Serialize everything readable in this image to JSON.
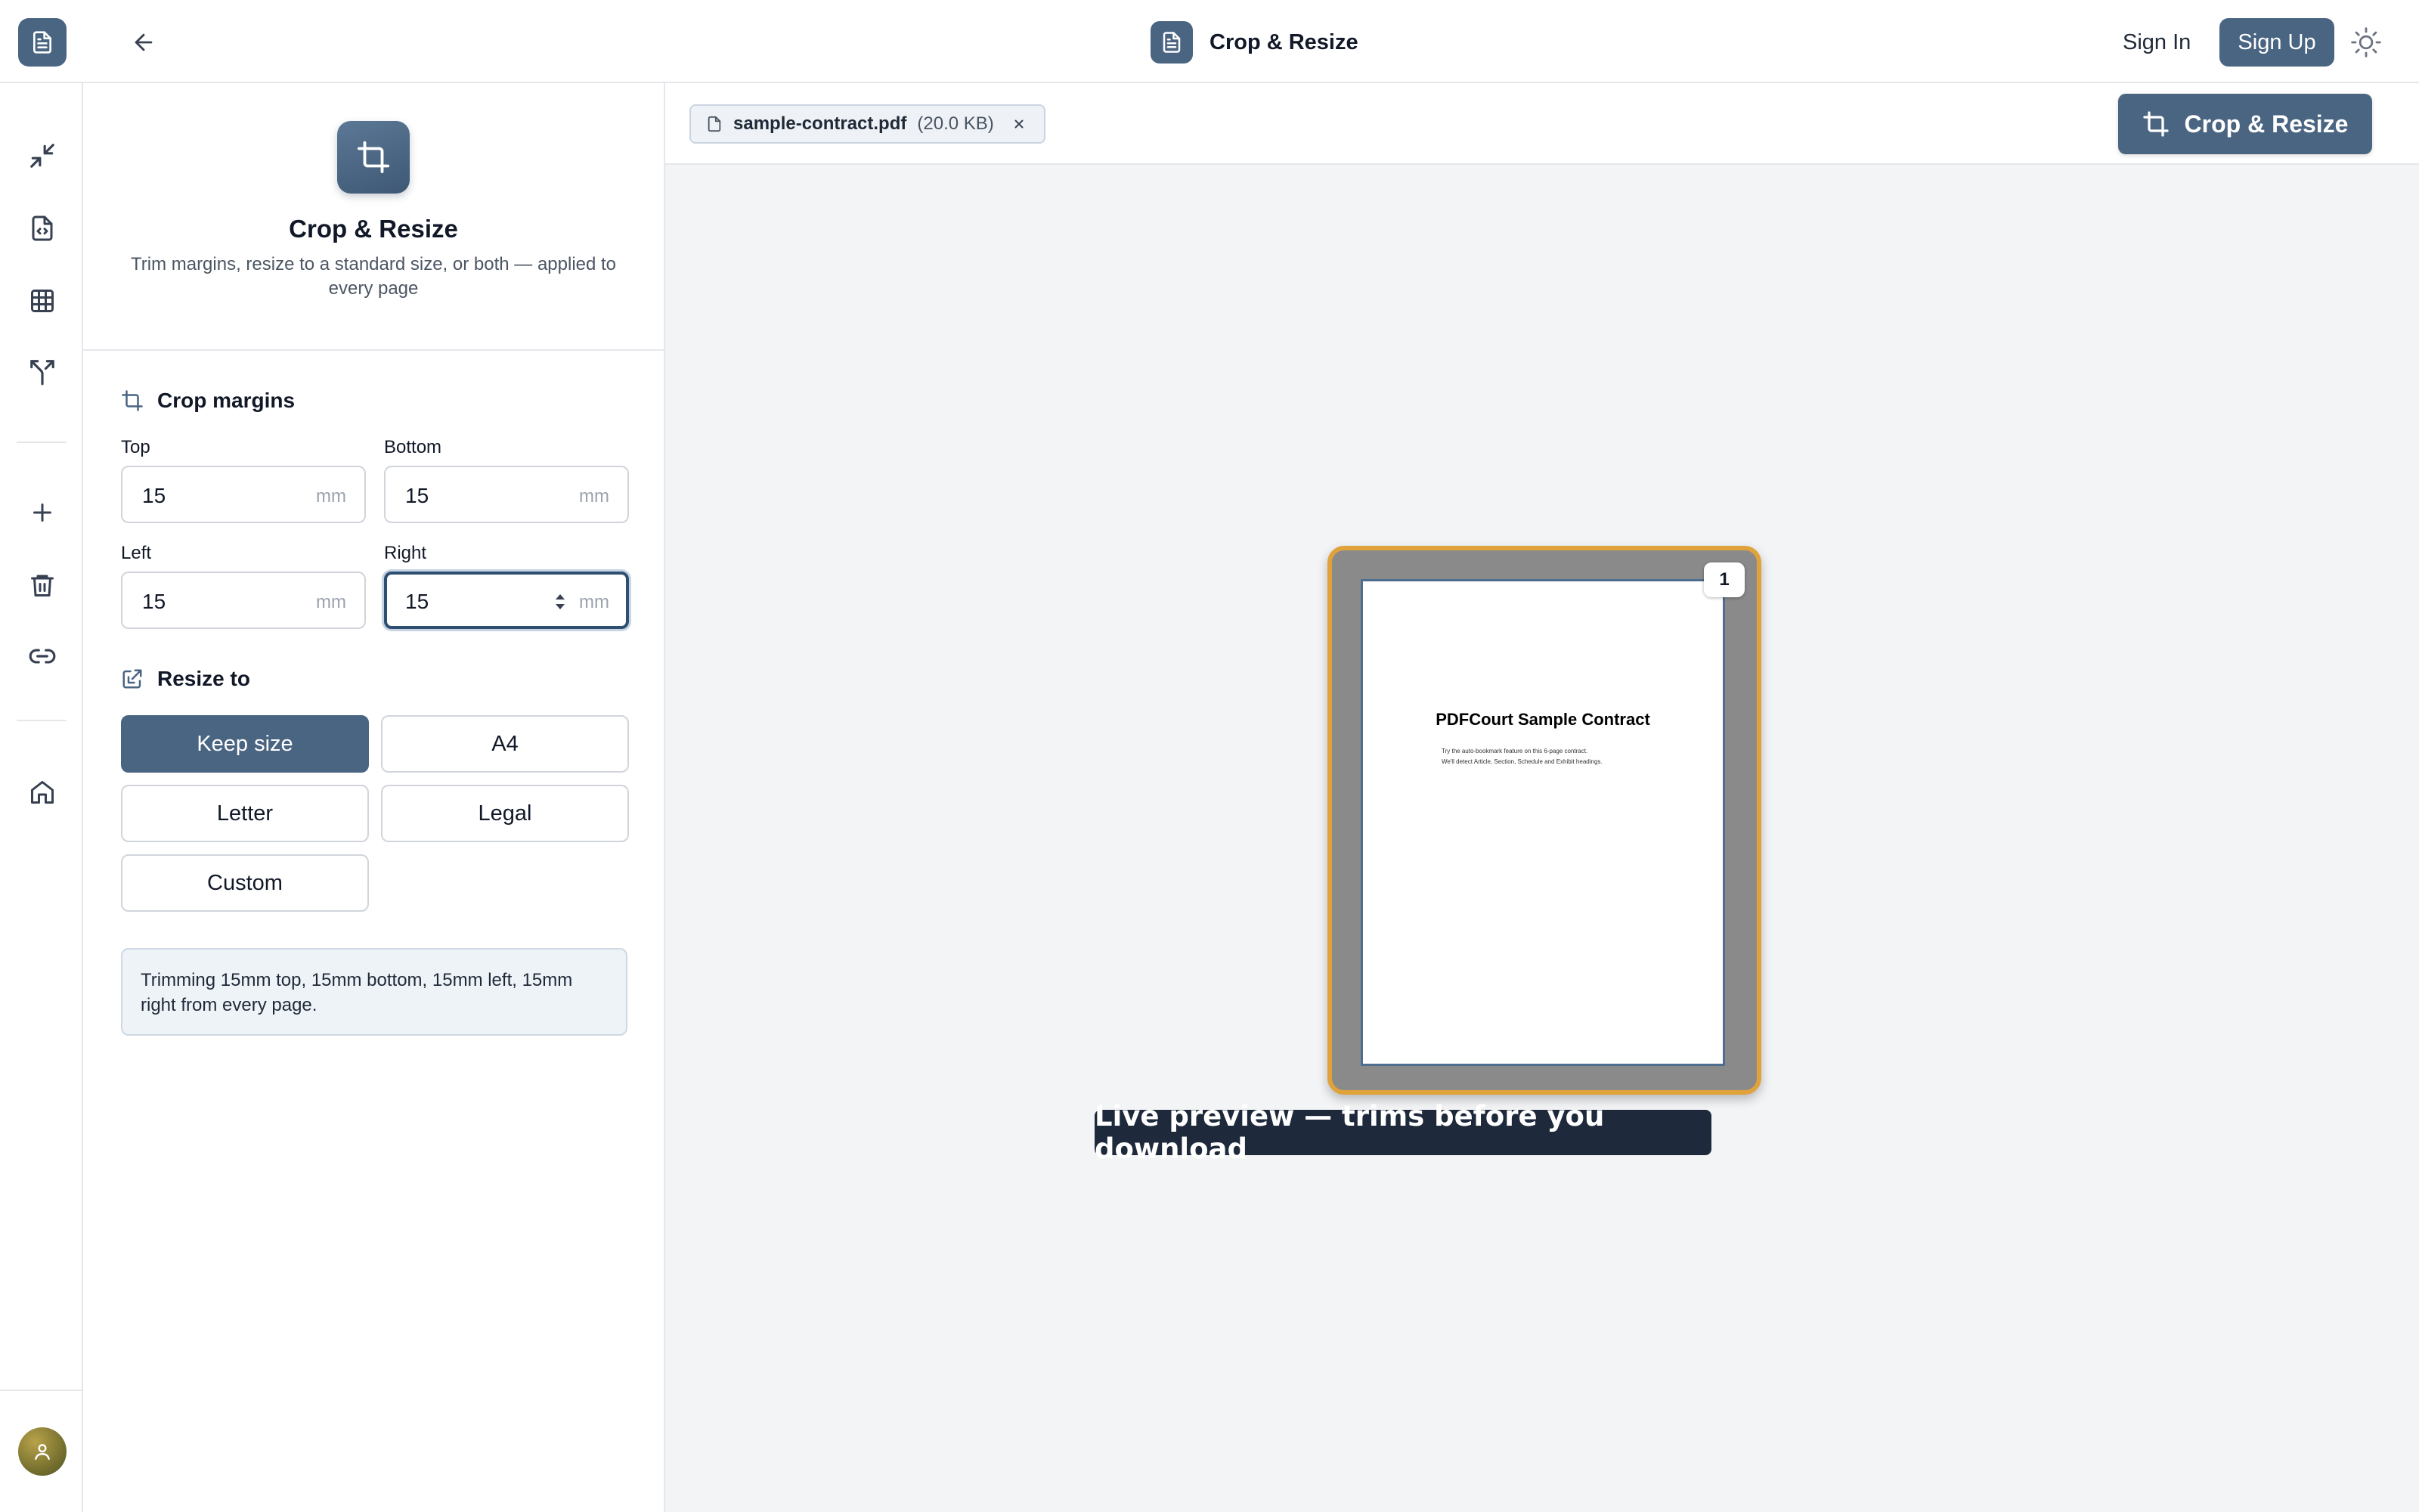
{
  "header": {
    "title": "Crop & Resize",
    "sign_in": "Sign In",
    "sign_up": "Sign Up"
  },
  "rail": {
    "items": [
      "compress-icon",
      "file-code-icon",
      "table-icon",
      "split-icon",
      "plus-icon",
      "trash-icon",
      "link-icon",
      "home-icon"
    ]
  },
  "panel": {
    "title": "Crop & Resize",
    "description": "Trim margins, resize to a standard size, or both — applied to every page",
    "crop": {
      "heading": "Crop margins",
      "unit": "mm",
      "top": {
        "label": "Top",
        "value": "15"
      },
      "bottom": {
        "label": "Bottom",
        "value": "15"
      },
      "left": {
        "label": "Left",
        "value": "15"
      },
      "right": {
        "label": "Right",
        "value": "15"
      }
    },
    "resize": {
      "heading": "Resize to",
      "options": [
        "Keep size",
        "A4",
        "Letter",
        "Legal",
        "Custom"
      ],
      "selected": "Keep size"
    },
    "summary": "Trimming 15mm top, 15mm bottom, 15mm left, 15mm right from every page."
  },
  "main": {
    "file": {
      "name": "sample-contract.pdf",
      "size": "(20.0 KB)"
    },
    "run_button": "Crop & Resize",
    "page": {
      "number": "1",
      "heading": "PDFCourt Sample Contract",
      "line1": "Try the auto-bookmark feature on this 6-page contract.",
      "line2": "We'll detect Article, Section, Schedule and Exhibit headings."
    },
    "caption": "Live preview — trims before you download"
  },
  "colors": {
    "accent": "#4a6582",
    "highlight": "#e0a23a"
  }
}
